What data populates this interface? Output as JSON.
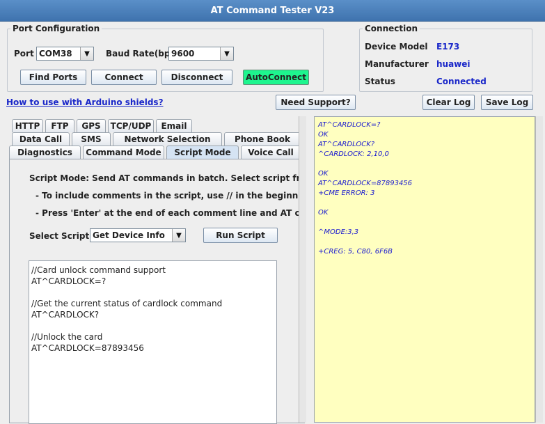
{
  "window": {
    "title": "AT Command Tester V23"
  },
  "port_config": {
    "legend": "Port Configuration",
    "port_label": "Port",
    "port_value": "COM38",
    "baud_label": "Baud Rate(bps)",
    "baud_value": "9600",
    "buttons": {
      "find_ports": "Find Ports",
      "connect": "Connect",
      "disconnect": "Disconnect",
      "autoconnect": "AutoConnect"
    }
  },
  "connection": {
    "legend": "Connection",
    "device_model_label": "Device Model",
    "device_model_value": "E173",
    "manufacturer_label": "Manufacturer",
    "manufacturer_value": "huawei",
    "status_label": "Status",
    "status_value": "Connected"
  },
  "toolbar": {
    "arduino_link": "How to use with Arduino shields?",
    "need_support": "Need Support?",
    "clear_log": "Clear Log",
    "save_log": "Save Log"
  },
  "tabs": {
    "row1": [
      "HTTP",
      "FTP",
      "GPS",
      "TCP/UDP",
      "Email"
    ],
    "row2": [
      "Data Call",
      "SMS",
      "Network Selection",
      "Phone Book"
    ],
    "row3": [
      "Diagnostics",
      "Command Mode",
      "Script Mode",
      "Voice Call"
    ]
  },
  "script_mode": {
    "line1": "Script Mode: Send AT commands in batch. Select script from the drop",
    "line2": "- To include comments in the script, use // in the beginning of the line",
    "line3": "- Press 'Enter' at the end of each comment line and AT command line",
    "select_label": "Select Script",
    "select_value": "Get Device Info",
    "run_button": "Run Script",
    "editor_text": "//Card unlock command support\nAT^CARDLOCK=?\n\n//Get the current status of cardlock command\nAT^CARDLOCK?\n\n//Unlock the card\nAT^CARDLOCK=87893456"
  },
  "log": {
    "text": "AT^CARDLOCK=?\nOK\nAT^CARDLOCK?\n^CARDLOCK: 2,10,0\n\nOK\nAT^CARDLOCK=87893456\n+CME ERROR: 3\n\nOK\n\n^MODE:3,3\n\n+CREG: 5, C80, 6F6B"
  },
  "colors": {
    "title_bar": "#4a80bd",
    "accent_text": "#1a27c9",
    "autoconnect": "#1ef58e",
    "log_bg": "#ffffc0"
  }
}
